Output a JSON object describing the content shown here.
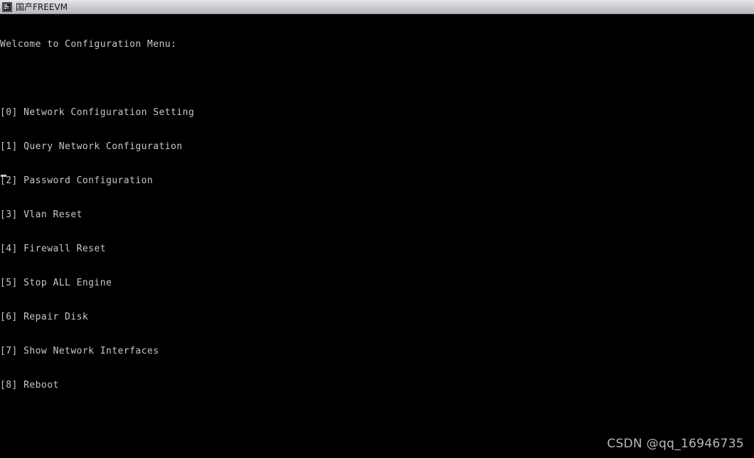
{
  "window": {
    "title": "国产FREEVM",
    "icon": "terminal-icon",
    "titlebar_text_color": "#15171a",
    "titlebar_gradient_top": "#e8e8ea",
    "titlebar_gradient_bottom": "#b6b8bd"
  },
  "console": {
    "background_color": "#000000",
    "text_color": "#c8c8c8",
    "heading": "Welcome to Configuration Menu:",
    "blank_line": "",
    "cursor": "_",
    "menu": [
      {
        "key": "[0]",
        "label": "Network Configuration Setting",
        "line": "[0] Network Configuration Setting"
      },
      {
        "key": "[1]",
        "label": "Query Network Configuration",
        "line": "[1] Query Network Configuration"
      },
      {
        "key": "[2]",
        "label": "Password Configuration",
        "line": "[2] Password Configuration"
      },
      {
        "key": "[3]",
        "label": "Vlan Reset",
        "line": "[3] Vlan Reset"
      },
      {
        "key": "[4]",
        "label": "Firewall Reset",
        "line": "[4] Firewall Reset"
      },
      {
        "key": "[5]",
        "label": "Stop ALL Engine",
        "line": "[5] Stop ALL Engine"
      },
      {
        "key": "[6]",
        "label": "Repair Disk",
        "line": "[6] Repair Disk"
      },
      {
        "key": "[7]",
        "label": "Show Network Interfaces",
        "line": "[7] Show Network Interfaces"
      },
      {
        "key": "[8]",
        "label": "Reboot",
        "line": "[8] Reboot"
      }
    ]
  },
  "watermark": {
    "text": "CSDN @qq_16946735",
    "color": "#b9b9b9"
  }
}
